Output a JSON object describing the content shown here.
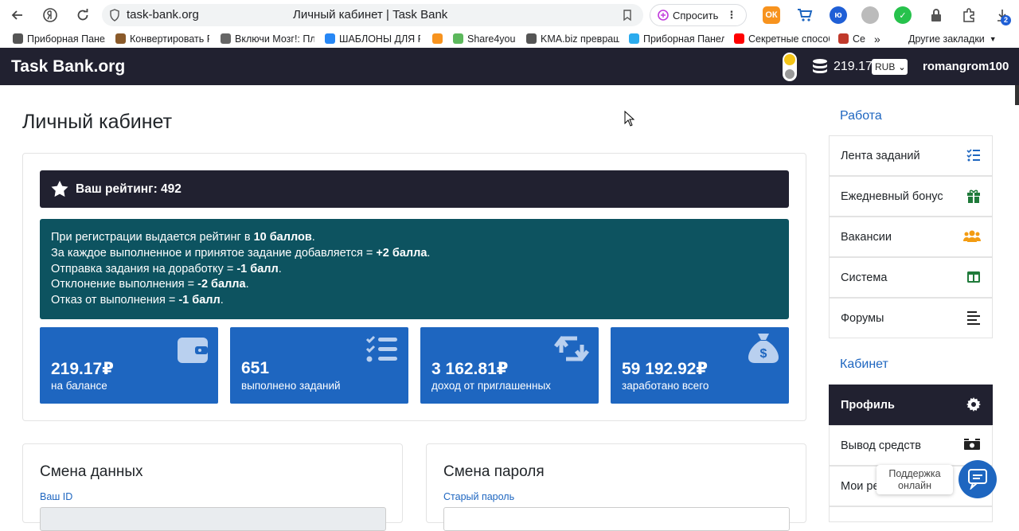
{
  "browser": {
    "url_host": "task-bank.org",
    "page_title": "Личный кабинет | Task Bank",
    "ask_label": "Спросить",
    "download_badge": "2",
    "bookmarks": [
      {
        "label": "Приборная Панель",
        "icon": "dashboard-favicon",
        "color": "#555555"
      },
      {
        "label": "Конвертировать PDF",
        "icon": "fox-favicon",
        "color": "#8a5a2a"
      },
      {
        "label": "Включи Мозг!: Пл",
        "icon": "brain-favicon",
        "color": "#666666"
      },
      {
        "label": "ШАБЛОНЫ ДЛЯ Р",
        "icon": "vk-favicon",
        "color": "#2787f5"
      },
      {
        "label": "",
        "icon": "odnoklassniki-favicon",
        "color": "#f7931e"
      },
      {
        "label": "Share4you",
        "icon": "share4you-favicon",
        "color": "#5cb85c"
      },
      {
        "label": "KMA.biz превращ",
        "icon": "kma-favicon",
        "color": "#555555"
      },
      {
        "label": "Приборная Панель",
        "icon": "telegram-favicon",
        "color": "#2aabee"
      },
      {
        "label": "Секретные способ",
        "icon": "youtube-favicon",
        "color": "#ff0000"
      },
      {
        "label": "Се",
        "icon": "k-favicon",
        "color": "#c0392b"
      }
    ],
    "more_bookmarks": "»",
    "other_bookmarks": "Другие закладки"
  },
  "header": {
    "logo": "Task Bank.org",
    "balance": "219.17",
    "currency": "RUB",
    "username": "romangrom100"
  },
  "page": {
    "title": "Личный кабинет",
    "rating": "Ваш рейтинг: 492",
    "info_lines": [
      {
        "pre": "При регистрации выдается рейтинг в ",
        "bold": "10 баллов",
        "post": "."
      },
      {
        "pre": "За каждое выполненное и принятое задание добавляется = ",
        "bold": "+2 балла",
        "post": "."
      },
      {
        "pre": "Отправка задания на доработку = ",
        "bold": "-1 балл",
        "post": "."
      },
      {
        "pre": "Отклонение выполнения = ",
        "bold": "-2 балла",
        "post": "."
      },
      {
        "pre": "Отказ от выполнения = ",
        "bold": "-1 балл",
        "post": "."
      }
    ],
    "stats": [
      {
        "value": "219.17₽",
        "label": "на балансе",
        "icon": "wallet-icon"
      },
      {
        "value": "651",
        "label": "выполнено заданий",
        "icon": "tasks-icon"
      },
      {
        "value": "3 162.81₽",
        "label": "доход от приглашенных",
        "icon": "retweet-icon"
      },
      {
        "value": "59 192.92₽",
        "label": "заработано всего",
        "icon": "money-bag-icon"
      }
    ],
    "change_data": {
      "title": "Смена данных",
      "id_label": "Ваш ID"
    },
    "change_password": {
      "title": "Смена пароля",
      "old_label": "Старый пароль"
    }
  },
  "sidebar": {
    "work_heading": "Работа",
    "work_items": [
      {
        "label": "Лента заданий",
        "icon": "task-list-icon",
        "color": "#1e66c0"
      },
      {
        "label": "Ежедневный бонус",
        "icon": "gift-icon",
        "color": "#1f7a3a"
      },
      {
        "label": "Вакансии",
        "icon": "users-icon",
        "color": "#f39c12"
      },
      {
        "label": "Система",
        "icon": "columns-icon",
        "color": "#1f7a3a"
      },
      {
        "label": "Форумы",
        "icon": "align-left-icon",
        "color": "#222222"
      }
    ],
    "cabinet_heading": "Кабинет",
    "cabinet_items": [
      {
        "label": "Профиль",
        "icon": "gear-icon",
        "active": true
      },
      {
        "label": "Вывод средств",
        "icon": "money-icon",
        "active": false
      },
      {
        "label": "Мои ре",
        "icon": "",
        "active": false
      }
    ]
  },
  "support": {
    "label_1": "Поддержка",
    "label_2": "онлайн"
  }
}
